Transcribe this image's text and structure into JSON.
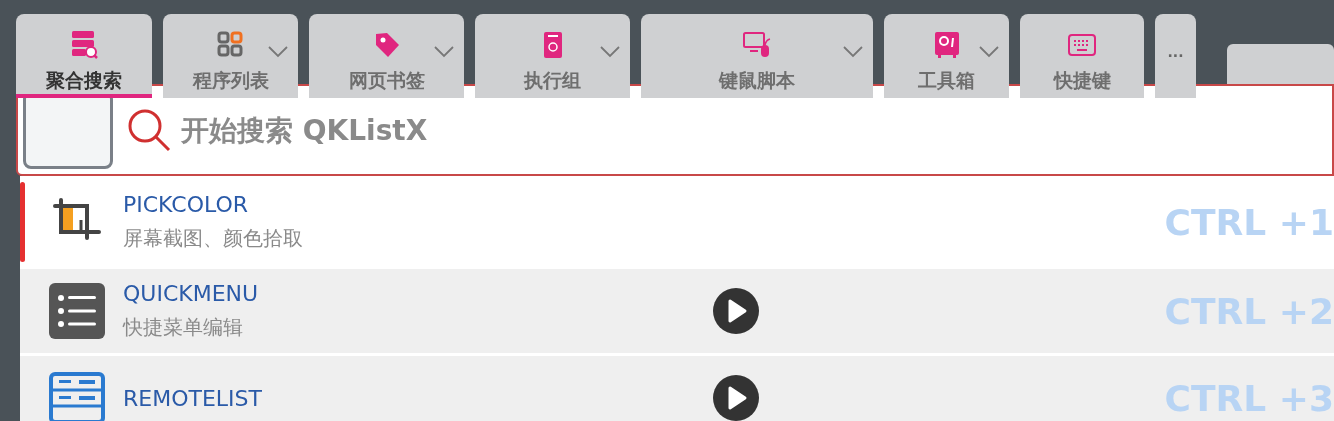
{
  "tabs": [
    {
      "label": "聚合搜索",
      "selected": true,
      "dropdown": false
    },
    {
      "label": "程序列表",
      "selected": false,
      "dropdown": true
    },
    {
      "label": "网页书签",
      "selected": false,
      "dropdown": true
    },
    {
      "label": "执行组",
      "selected": false,
      "dropdown": true
    },
    {
      "label": "键鼠脚本",
      "selected": false,
      "dropdown": true
    },
    {
      "label": "工具箱",
      "selected": false,
      "dropdown": true
    },
    {
      "label": "快捷键",
      "selected": false,
      "dropdown": false
    }
  ],
  "more_button": "···",
  "search": {
    "placeholder": "开始搜索 QKListX"
  },
  "results": [
    {
      "title": "PICKCOLOR",
      "subtitle": "屏幕截图、颜色拾取",
      "shortcut": "CTRL +1",
      "selected": true,
      "runnable": false
    },
    {
      "title": "QUICKMENU",
      "subtitle": "快捷菜单编辑",
      "shortcut": "CTRL +2",
      "selected": false,
      "runnable": true
    },
    {
      "title": "REMOTELIST",
      "shortcut": "CTRL +3",
      "selected": false,
      "runnable": true
    }
  ]
}
